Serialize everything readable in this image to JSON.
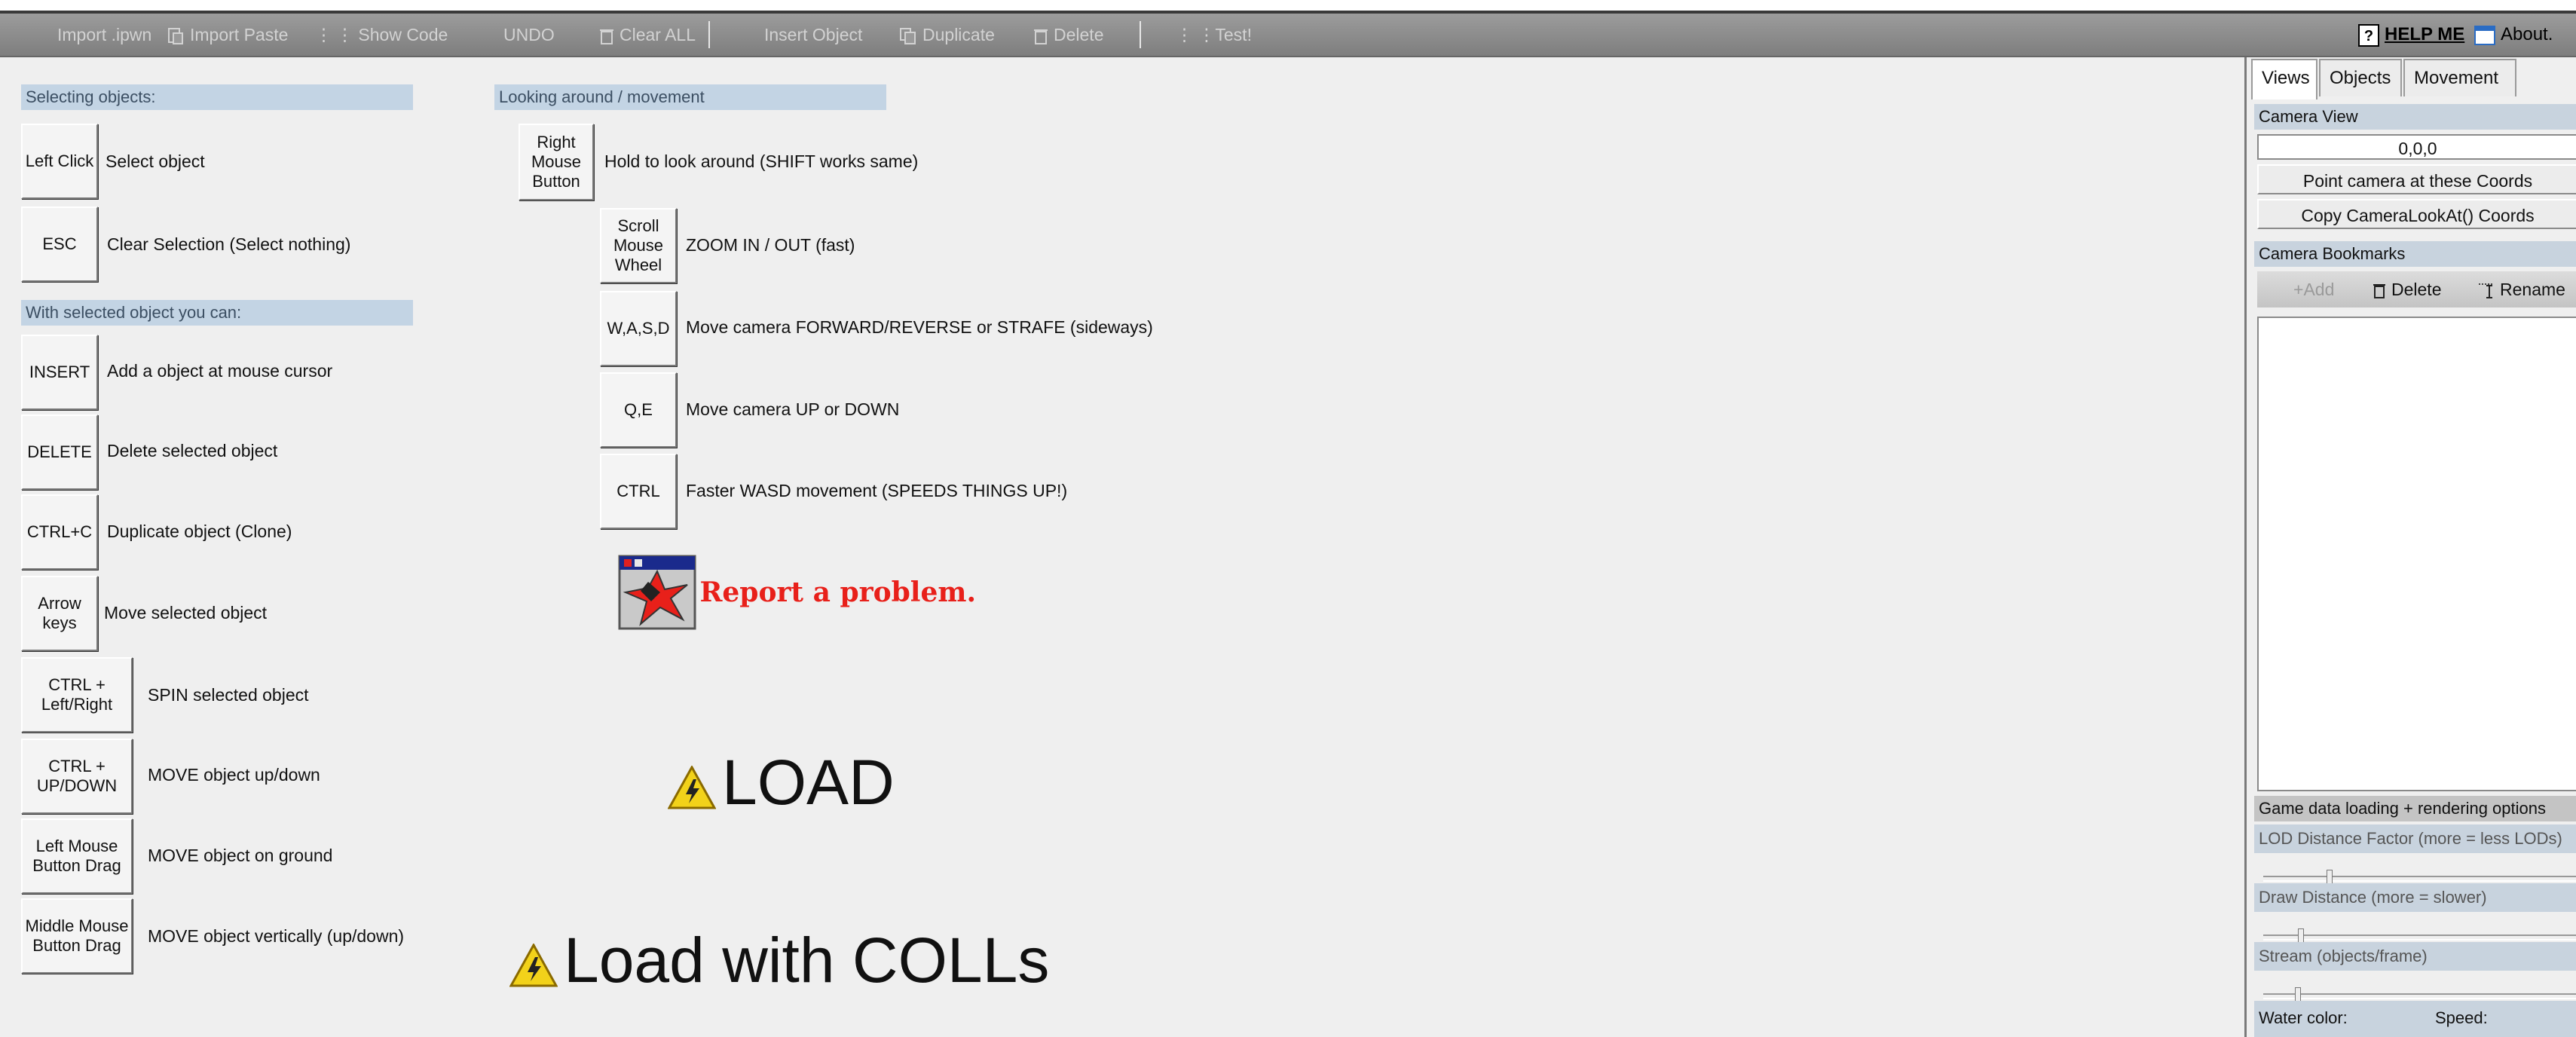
{
  "toolbar": {
    "import_ipwn": "Import .ipwn",
    "import_paste": "Import Paste",
    "show_code": "Show Code",
    "undo": "UNDO",
    "clear_all": "Clear ALL",
    "insert_object": "Insert Object",
    "duplicate": "Duplicate",
    "delete": "Delete",
    "test": "Test!",
    "help_me": "HELP ME",
    "about": "About."
  },
  "selecting": {
    "title": "Selecting objects:",
    "rows": [
      {
        "key": "Left Click",
        "desc": "Select object"
      },
      {
        "key": "ESC",
        "desc": "Clear Selection (Select nothing)"
      }
    ]
  },
  "selected": {
    "title": "With selected object you can:",
    "rows": [
      {
        "key": "INSERT",
        "desc": "Add a object at mouse cursor"
      },
      {
        "key": "DELETE",
        "desc": "Delete selected object"
      },
      {
        "key": "CTRL+C",
        "desc": "Duplicate object (Clone)"
      },
      {
        "key": "Arrow keys",
        "desc": "Move selected object"
      },
      {
        "key": "CTRL + Left/Right",
        "desc": "SPIN selected object"
      },
      {
        "key": "CTRL + UP/DOWN",
        "desc": "MOVE object up/down"
      },
      {
        "key": "Left Mouse Button Drag",
        "desc": "MOVE object on ground"
      },
      {
        "key": "Middle Mouse Button Drag",
        "desc": "MOVE object vertically (up/down)"
      }
    ]
  },
  "looking": {
    "title": "Looking around / movement",
    "rows": [
      {
        "key": "Right Mouse Button",
        "desc": "Hold to look around (SHIFT works same)"
      },
      {
        "key": "Scroll Mouse Wheel",
        "desc": "ZOOM IN / OUT (fast)"
      },
      {
        "key": "W,A,S,D",
        "desc": "Move camera FORWARD/REVERSE or STRAFE (sideways)"
      },
      {
        "key": "Q,E",
        "desc": "Move camera UP or DOWN"
      },
      {
        "key": "CTRL",
        "desc": "Faster WASD movement (SPEEDS THINGS UP!)"
      }
    ]
  },
  "report": "Report a problem.",
  "load": "LOAD",
  "load_colls": "Load with COLLs",
  "panel": {
    "tabs": [
      "Views",
      "Objects",
      "Movement"
    ],
    "camera_view_title": "Camera View",
    "coords": "0,0,0",
    "point_camera": "Point camera at these Coords",
    "copy_lookat": "Copy CameraLookAt() Coords",
    "bookmarks_title": "Camera Bookmarks",
    "bm_add": "Add",
    "bm_delete": "Delete",
    "bm_rename": "Rename",
    "loading_title": "Game data loading + rendering options",
    "lod_label": "LOD Distance Factor (more = less LODs)",
    "draw_label": "Draw Distance (more = slower)",
    "stream_label": "Stream (objects/frame)",
    "water_label": "Water color:",
    "speed_label": "Speed:"
  },
  "colors": {
    "section_bg": "#c3d4e4",
    "toolbar_bg": "#8c8c8c",
    "report_red": "#e8201a"
  }
}
